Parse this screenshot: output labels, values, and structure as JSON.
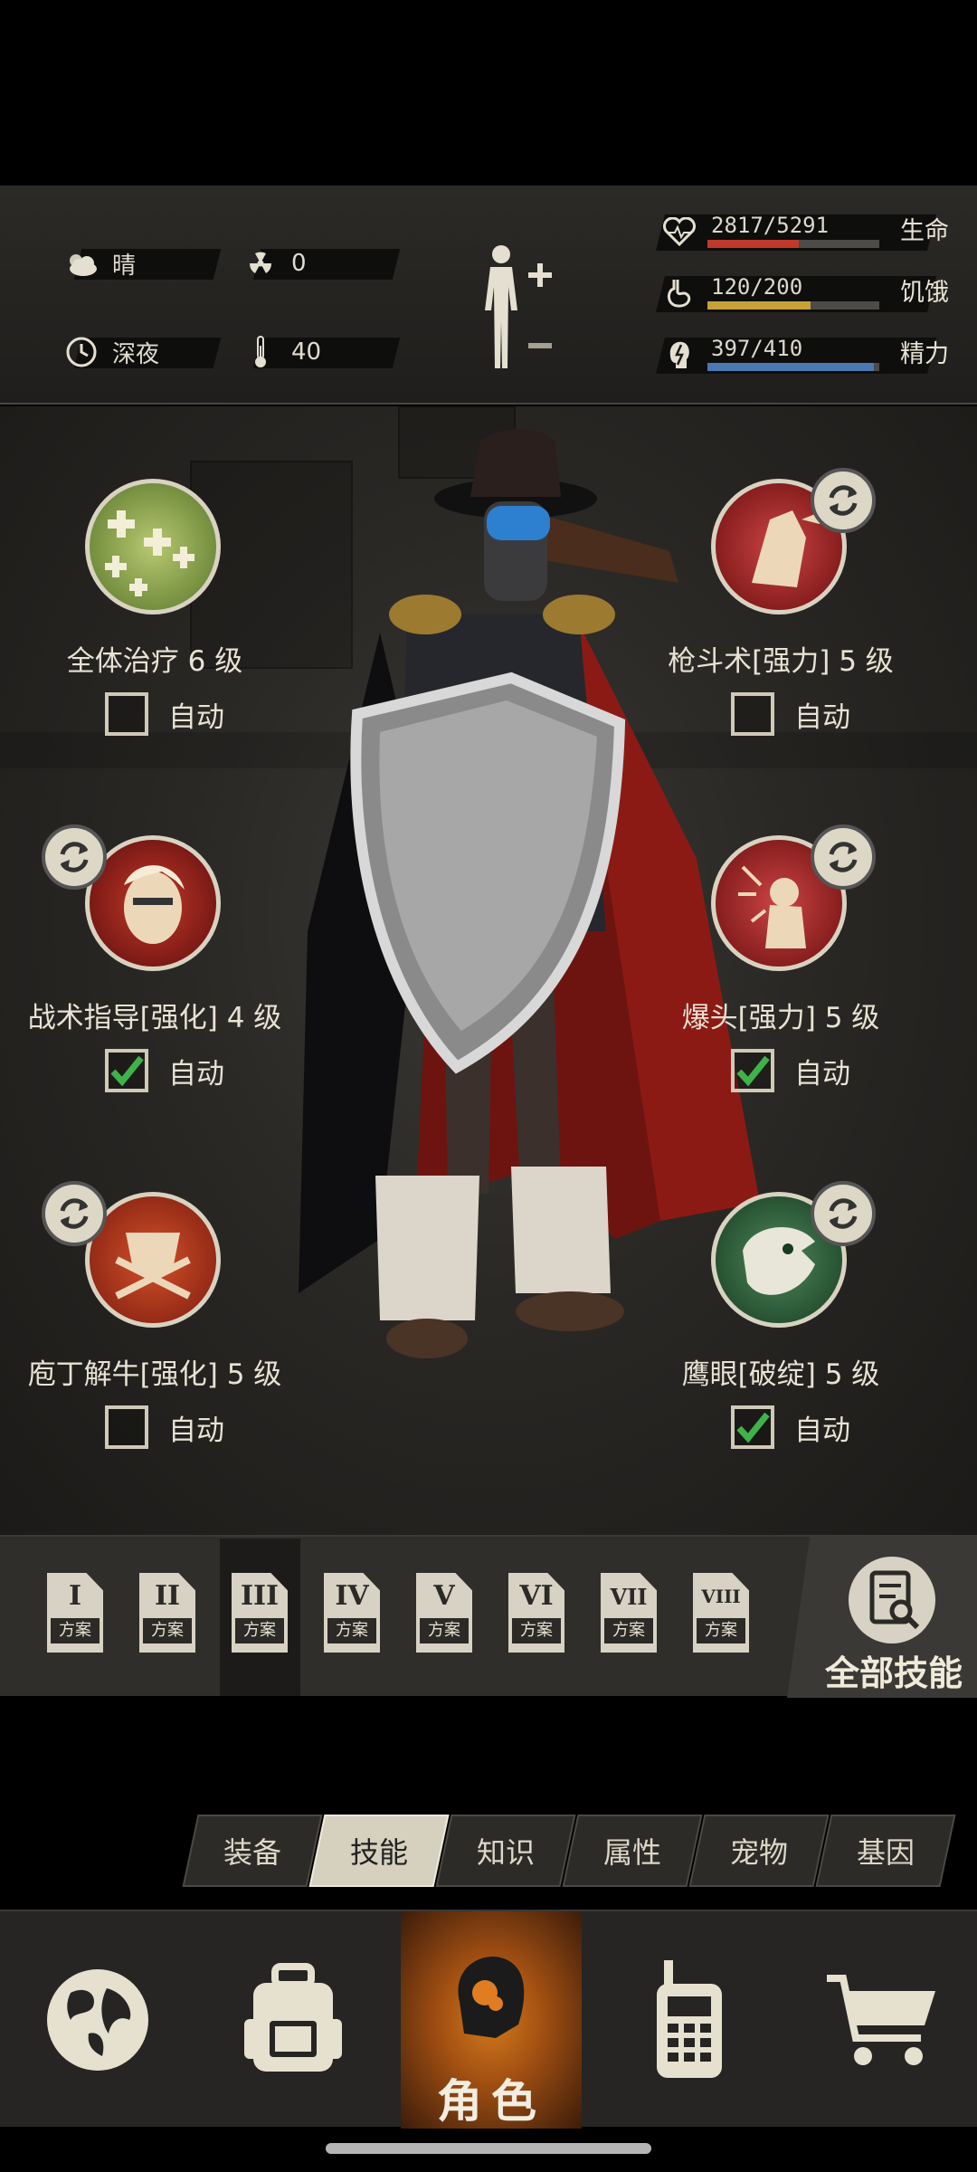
{
  "status": {
    "weather": "晴",
    "radiation": "0",
    "time_of_day": "深夜",
    "temperature": "40",
    "vitals": [
      {
        "name": "生命",
        "value": "2817/5291",
        "fraction": 0.532,
        "color": "#c0392b",
        "icon": "heart-icon"
      },
      {
        "name": "饥饿",
        "value": "120/200",
        "fraction": 0.6,
        "color": "#c8a038",
        "icon": "stomach-icon"
      },
      {
        "name": "精力",
        "value": "397/410",
        "fraction": 0.968,
        "color": "#4a78b0",
        "icon": "energy-icon"
      }
    ]
  },
  "skills": [
    {
      "label": "全体治疗 6 级",
      "auto_label": "自动",
      "auto": false,
      "swappable": false,
      "icon": "group-heal-icon"
    },
    {
      "label": "枪斗术[强力] 5 级",
      "auto_label": "自动",
      "auto": false,
      "swappable": true,
      "icon": "gun-fu-icon"
    },
    {
      "label": "战术指导[强化] 4 级",
      "auto_label": "自动",
      "auto": true,
      "swappable": true,
      "icon": "tactical-guidance-icon"
    },
    {
      "label": "爆头[强力] 5 级",
      "auto_label": "自动",
      "auto": true,
      "swappable": true,
      "icon": "headshot-icon"
    },
    {
      "label": "庖丁解牛[强化] 5 级",
      "auto_label": "自动",
      "auto": false,
      "swappable": true,
      "icon": "butcher-icon"
    },
    {
      "label": "鹰眼[破绽] 5 级",
      "auto_label": "自动",
      "auto": true,
      "swappable": true,
      "icon": "hawk-eye-icon"
    }
  ],
  "plans": {
    "items": [
      {
        "num": "I",
        "sub": "方案"
      },
      {
        "num": "II",
        "sub": "方案"
      },
      {
        "num": "III",
        "sub": "方案"
      },
      {
        "num": "IV",
        "sub": "方案"
      },
      {
        "num": "V",
        "sub": "方案"
      },
      {
        "num": "VI",
        "sub": "方案"
      },
      {
        "num": "VII",
        "sub": "方案"
      },
      {
        "num": "VIII",
        "sub": "方案"
      }
    ],
    "selected": 2,
    "all_skills_label": "全部技能"
  },
  "tabs": [
    {
      "label": "装备",
      "active": false
    },
    {
      "label": "技能",
      "active": true
    },
    {
      "label": "知识",
      "active": false
    },
    {
      "label": "属性",
      "active": false
    },
    {
      "label": "宠物",
      "active": false
    },
    {
      "label": "基因",
      "active": false
    }
  ],
  "nav": {
    "items": [
      "globe-icon",
      "backpack-icon",
      "character-icon",
      "radio-icon",
      "cart-icon"
    ],
    "active_label": "角色"
  }
}
